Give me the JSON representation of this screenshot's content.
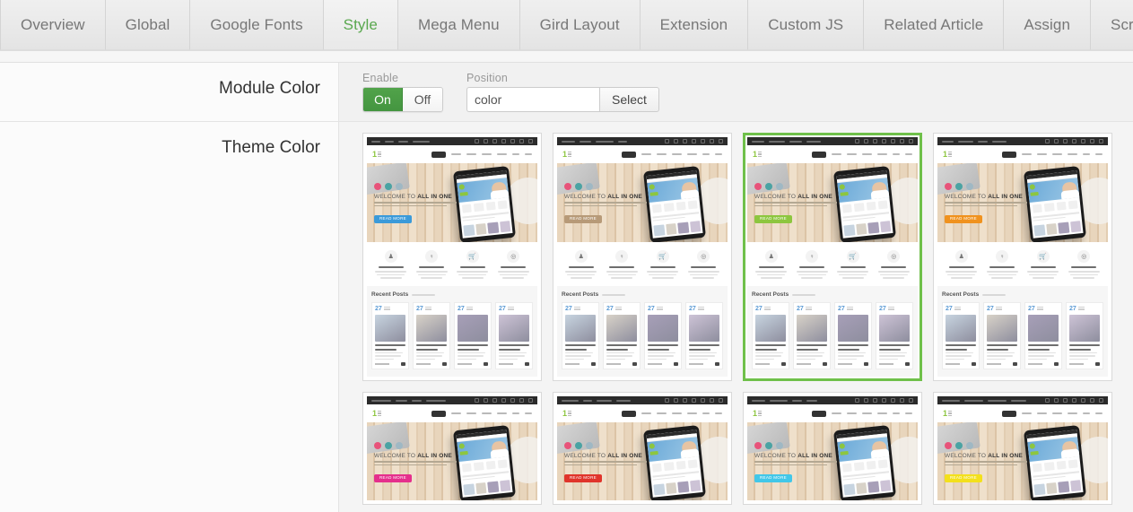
{
  "tabs": [
    {
      "label": "Overview",
      "active": false
    },
    {
      "label": "Global",
      "active": false
    },
    {
      "label": "Google Fonts",
      "active": false
    },
    {
      "label": "Style",
      "active": true
    },
    {
      "label": "Mega Menu",
      "active": false
    },
    {
      "label": "Gird Layout",
      "active": false
    },
    {
      "label": "Extension",
      "active": false
    },
    {
      "label": "Custom JS",
      "active": false
    },
    {
      "label": "Related Article",
      "active": false
    },
    {
      "label": "Assign",
      "active": false
    },
    {
      "label": "Scrolling Effect",
      "active": false
    }
  ],
  "rows": {
    "module_color": {
      "label": "Module Color",
      "enable": {
        "label": "Enable",
        "on_label": "On",
        "off_label": "Off",
        "value": "On"
      },
      "position": {
        "label": "Position",
        "value": "color",
        "placeholder": "color",
        "select_label": "Select"
      }
    },
    "theme_color": {
      "label": "Theme Color"
    }
  },
  "colors": {
    "accent_green": "#6fc04a",
    "toggle_on_green": "#51a34a",
    "active_tab_text": "#5aa84f",
    "tab_text": "#777777",
    "panel_bg": "#f1f1f1",
    "label_bg": "#fbfbfb"
  },
  "mock": {
    "hero_title_prefix": "WELCOME TO ",
    "hero_title_strong": "ALL IN ONE",
    "hero_button_label": "READ MORE",
    "posts_title": "Recent Posts",
    "post_day": "27",
    "social_colors": [
      "#e8537a",
      "#4aa3a3",
      "#9fb8c4"
    ],
    "post_image_colors": [
      "#c7d4e0",
      "#d8d2c8",
      "#a79fb8",
      "#cdc3d6"
    ]
  },
  "themes": [
    {
      "id": "theme-1",
      "accent": "#3b9ad9",
      "selected": false,
      "row": 1
    },
    {
      "id": "theme-2",
      "accent": "#b79a78",
      "selected": false,
      "row": 1
    },
    {
      "id": "theme-3",
      "accent": "#8dc63f",
      "selected": true,
      "row": 1
    },
    {
      "id": "theme-4",
      "accent": "#f0921e",
      "selected": false,
      "row": 1
    },
    {
      "id": "theme-5",
      "accent": "#e52f8c",
      "selected": false,
      "row": 2
    },
    {
      "id": "theme-6",
      "accent": "#e0342b",
      "selected": false,
      "row": 2
    },
    {
      "id": "theme-7",
      "accent": "#42c7e8",
      "selected": false,
      "row": 2
    },
    {
      "id": "theme-8",
      "accent": "#f3e01c",
      "selected": false,
      "row": 2
    }
  ]
}
